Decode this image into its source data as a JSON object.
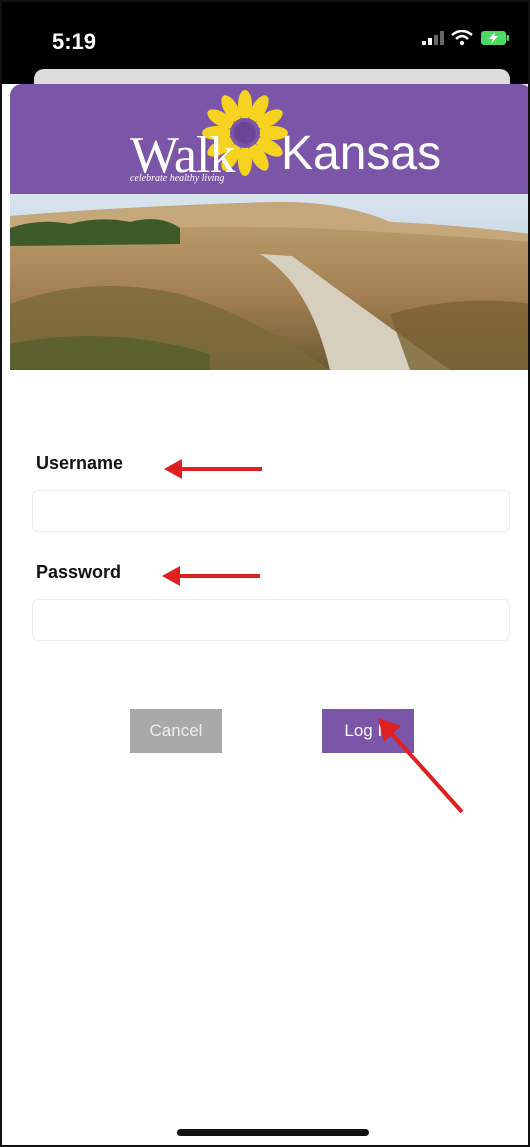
{
  "status_bar": {
    "time": "5:19",
    "icons": [
      "signal-icon",
      "wifi-icon",
      "battery-charging-icon"
    ]
  },
  "header": {
    "brand_color": "#7b55a8",
    "logo": {
      "word_left": "Walk",
      "word_right": "Kansas",
      "tagline": "celebrate healthy living"
    }
  },
  "form": {
    "username_label": "Username",
    "username_value": "",
    "password_label": "Password",
    "password_value": ""
  },
  "buttons": {
    "cancel": "Cancel",
    "login": "Log In"
  },
  "annotations": {
    "arrow_color": "#e02020",
    "arrows": [
      "arrow-to-username",
      "arrow-to-password",
      "arrow-to-login"
    ]
  }
}
